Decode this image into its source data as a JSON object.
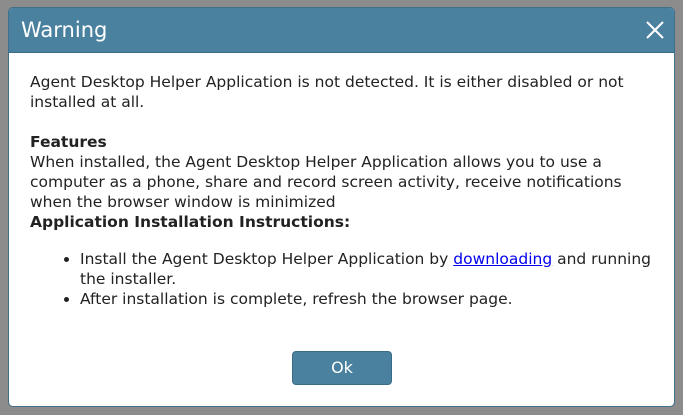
{
  "dialog": {
    "title": "Warning",
    "close_icon": "close-icon",
    "message": "Agent Desktop Helper Application is not detected. It is either disabled or not installed at all.",
    "features_heading": "Features",
    "features_text": "When installed, the Agent Desktop Helper Application allows you to use a computer as a phone, share and record screen activity, receive notifications when the browser window is minimized",
    "instructions_heading": "Application Installation Instructions:",
    "instructions": [
      {
        "before_link": "Install the Agent Desktop Helper Application by ",
        "link": "downloading",
        "after_link": " and running the installer."
      },
      {
        "text": "After installation is complete, refresh the browser page."
      }
    ],
    "ok_label": "Ok"
  },
  "colors": {
    "titlebar": "#4a819f",
    "backdrop": "#8c8c8c",
    "link": "#0000ee"
  }
}
